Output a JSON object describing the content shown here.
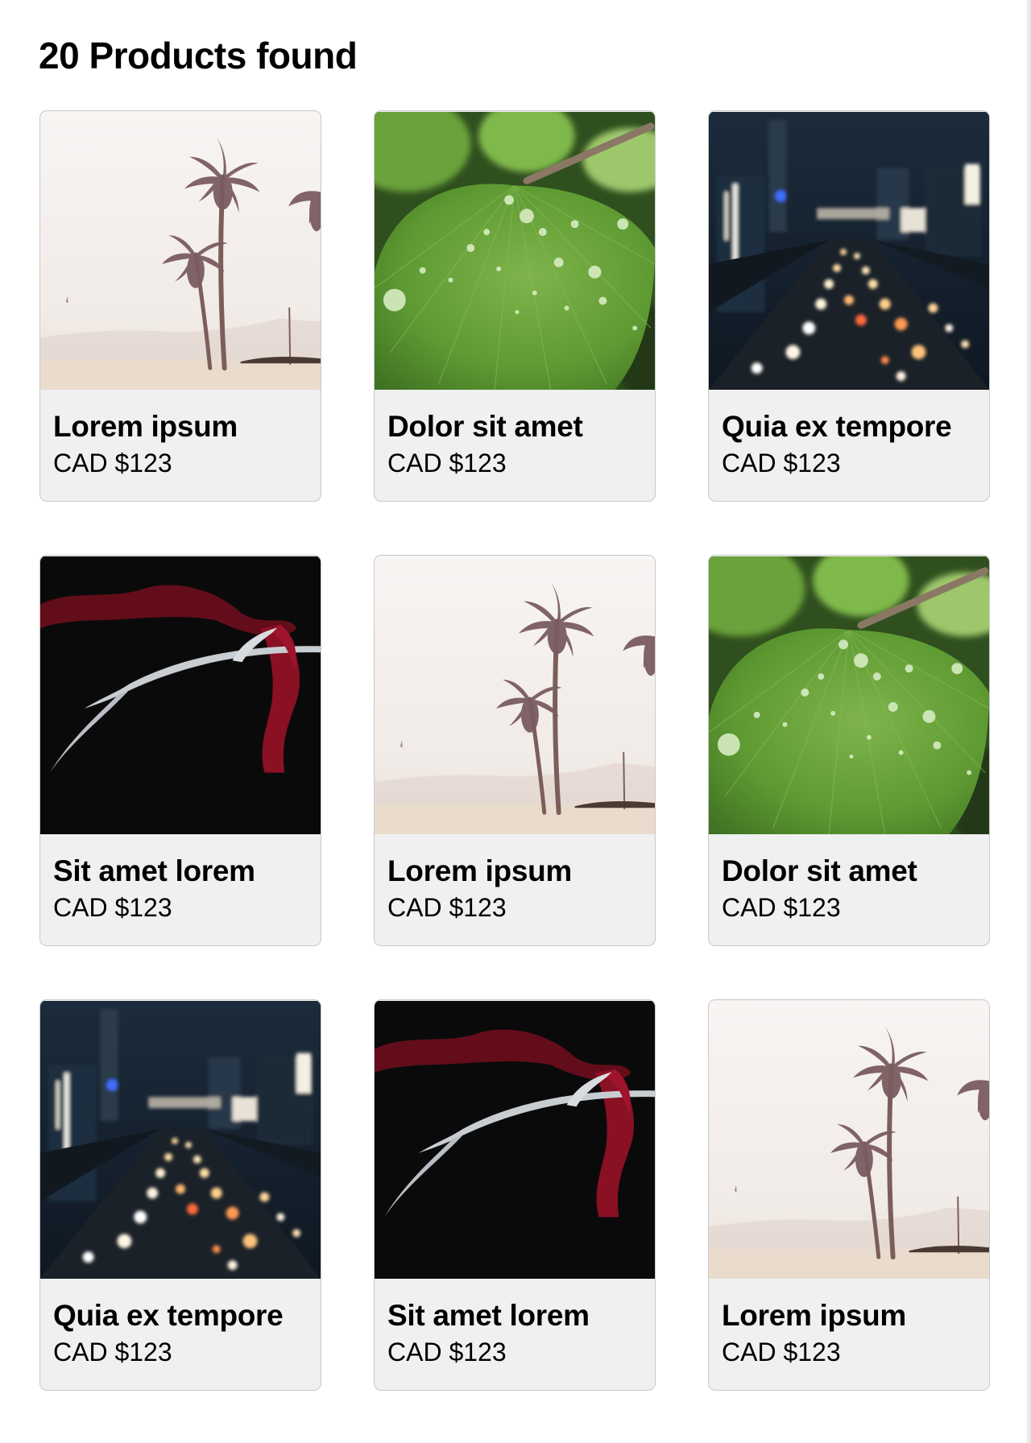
{
  "results": {
    "heading": "20 Products found"
  },
  "products": [
    {
      "name": "Lorem ipsum",
      "price": "CAD $123",
      "image": "palm-trees-beach"
    },
    {
      "name": "Dolor sit amet",
      "price": "CAD $123",
      "image": "green-leaf-water-drops"
    },
    {
      "name": "Quia ex tempore",
      "price": "CAD $123",
      "image": "city-traffic-night"
    },
    {
      "name": "Sit amet lorem",
      "price": "CAD $123",
      "image": "antler-red-ribbon"
    },
    {
      "name": "Lorem ipsum",
      "price": "CAD $123",
      "image": "palm-trees-beach"
    },
    {
      "name": "Dolor sit amet",
      "price": "CAD $123",
      "image": "green-leaf-water-drops"
    },
    {
      "name": "Quia ex tempore",
      "price": "CAD $123",
      "image": "city-traffic-night"
    },
    {
      "name": "Sit amet lorem",
      "price": "CAD $123",
      "image": "antler-red-ribbon"
    },
    {
      "name": "Lorem ipsum",
      "price": "CAD $123",
      "image": "palm-trees-beach"
    }
  ]
}
